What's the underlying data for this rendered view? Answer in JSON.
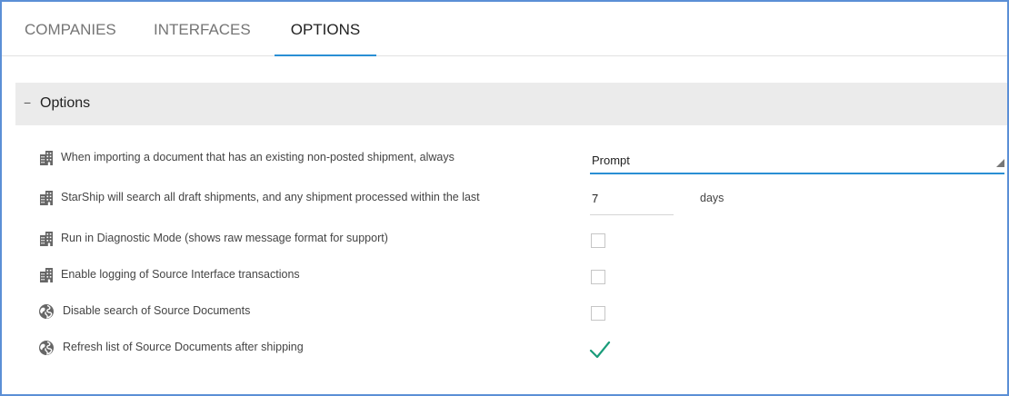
{
  "tabs": [
    {
      "label": "COMPANIES",
      "active": false
    },
    {
      "label": "INTERFACES",
      "active": false
    },
    {
      "label": "OPTIONS",
      "active": true
    }
  ],
  "section": {
    "toggle": "−",
    "title": "Options"
  },
  "options": {
    "import_behavior": {
      "label": "When importing a document that has an existing non-posted shipment, always",
      "icon": "building-icon",
      "value": "Prompt"
    },
    "search_days": {
      "label": "StarShip will search all draft shipments, and any shipment processed within the last",
      "icon": "building-icon",
      "value": "7",
      "unit": "days"
    },
    "diagnostic_mode": {
      "label": "Run in Diagnostic Mode (shows raw message format for support)",
      "icon": "building-icon",
      "checked": false
    },
    "logging": {
      "label": "Enable logging of Source Interface transactions",
      "icon": "building-icon",
      "checked": false
    },
    "disable_search": {
      "label": "Disable search of Source Documents",
      "icon": "globe-icon",
      "checked": false
    },
    "refresh_list": {
      "label": "Refresh list of Source Documents after shipping",
      "icon": "globe-icon",
      "checked": true
    }
  },
  "colors": {
    "accent": "#2a8fd4",
    "check": "#1a9c7a",
    "frame": "#5b8fd6",
    "header_bg": "#ebebeb",
    "icon": "#666666"
  }
}
